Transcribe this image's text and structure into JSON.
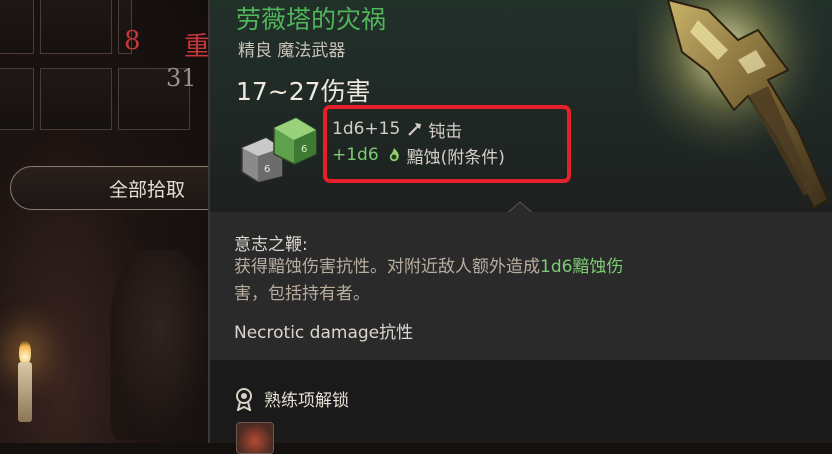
{
  "loot_window": {
    "count_a": "8",
    "count_a_suffix": "重",
    "weight": "31",
    "loot_all_label": "全部拾取"
  },
  "tooltip": {
    "item_name": "劳薇塔的灾祸",
    "item_type": "精良 魔法武器",
    "damage_total": "17~27伤害",
    "damage_lines": [
      {
        "dice": "1d6+15",
        "type": "钝击",
        "icon": "bludgeon-icon"
      },
      {
        "dice": "+1d6",
        "type": "黯蚀(附条件)",
        "icon": "necrotic-icon"
      }
    ],
    "ability_title": "意志之鞭:",
    "ability_desc_a": "获得黯蚀伤害抗性。对附近敌人额外造成",
    "ability_desc_hl": "1d6黯蚀伤",
    "ability_desc_b": "害，包括持有者。",
    "resistance": "Necrotic damage抗性",
    "proficiency_title": "熟练项解锁"
  },
  "colors": {
    "item_name": "#4fb65a",
    "highlight_box": "#e6202a",
    "necrotic_text": "#7ccc74"
  }
}
